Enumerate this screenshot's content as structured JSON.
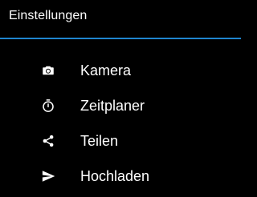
{
  "header": {
    "title": "Einstellungen",
    "accent_color": "#1f86cf"
  },
  "menu": {
    "items": [
      {
        "label": "Kamera",
        "icon": "camera-icon"
      },
      {
        "label": "Zeitplaner",
        "icon": "stopwatch-icon"
      },
      {
        "label": "Teilen",
        "icon": "share-icon"
      },
      {
        "label": "Hochladen",
        "icon": "send-icon"
      }
    ]
  }
}
